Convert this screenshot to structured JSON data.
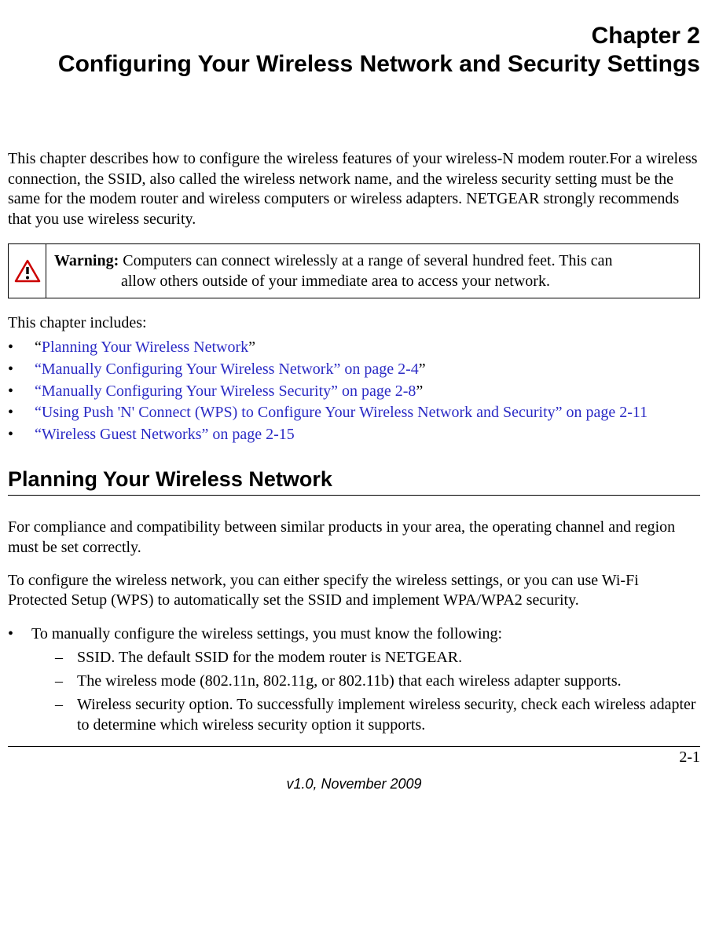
{
  "chapter": {
    "number_line": "Chapter 2",
    "title": "Configuring Your Wireless Network and Security Settings"
  },
  "intro_paragraph": "This chapter describes how to configure the wireless features of your wireless-N modem router.For a wireless connection, the SSID, also called the wireless network name, and the wireless security setting must be the same for the modem router and wireless computers or wireless adapters. NETGEAR strongly recommends that you use wireless security.",
  "warning": {
    "label": "Warning:",
    "text_line1": " Computers can connect wirelessly at a range of several hundred feet. This can",
    "text_line2": "allow others outside of your immediate area to access your network."
  },
  "includes_label": "This chapter includes:",
  "toc": [
    {
      "pre": "“",
      "link": "Planning Your Wireless Network",
      "post": "”"
    },
    {
      "pre": "",
      "link": "“Manually Configuring Your Wireless Network” on page 2-4",
      "post": "”"
    },
    {
      "pre": "",
      "link": "“Manually Configuring Your Wireless Security” on page 2-8",
      "post": "”"
    },
    {
      "pre": "",
      "link": "“Using Push 'N' Connect (WPS) to Configure Your Wireless Network and Security” on page 2-11",
      "post": ""
    },
    {
      "pre": "",
      "link": "“Wireless Guest Networks” on page 2-15",
      "post": ""
    }
  ],
  "section_heading": "Planning Your Wireless Network",
  "body": {
    "p1": "For compliance and compatibility between similar products in your area, the operating channel and region must be set correctly.",
    "p2": "To configure the wireless network, you can either specify the wireless settings, or you can use Wi-Fi Protected Setup (WPS) to automatically set the SSID and implement WPA/WPA2 security.",
    "bullet_intro": "To manually configure the wireless settings, you must know the following:",
    "sub_items": [
      "SSID. The default SSID for the modem router is NETGEAR.",
      "The wireless mode (802.11n, 802.11g, or 802.11b) that each wireless adapter supports.",
      "Wireless security option. To successfully implement wireless security, check each wireless adapter to determine which wireless security option it supports."
    ]
  },
  "page_number": "2-1",
  "version_footer": "v1.0, November 2009",
  "glyphs": {
    "bullet": "•",
    "dash": "–"
  }
}
